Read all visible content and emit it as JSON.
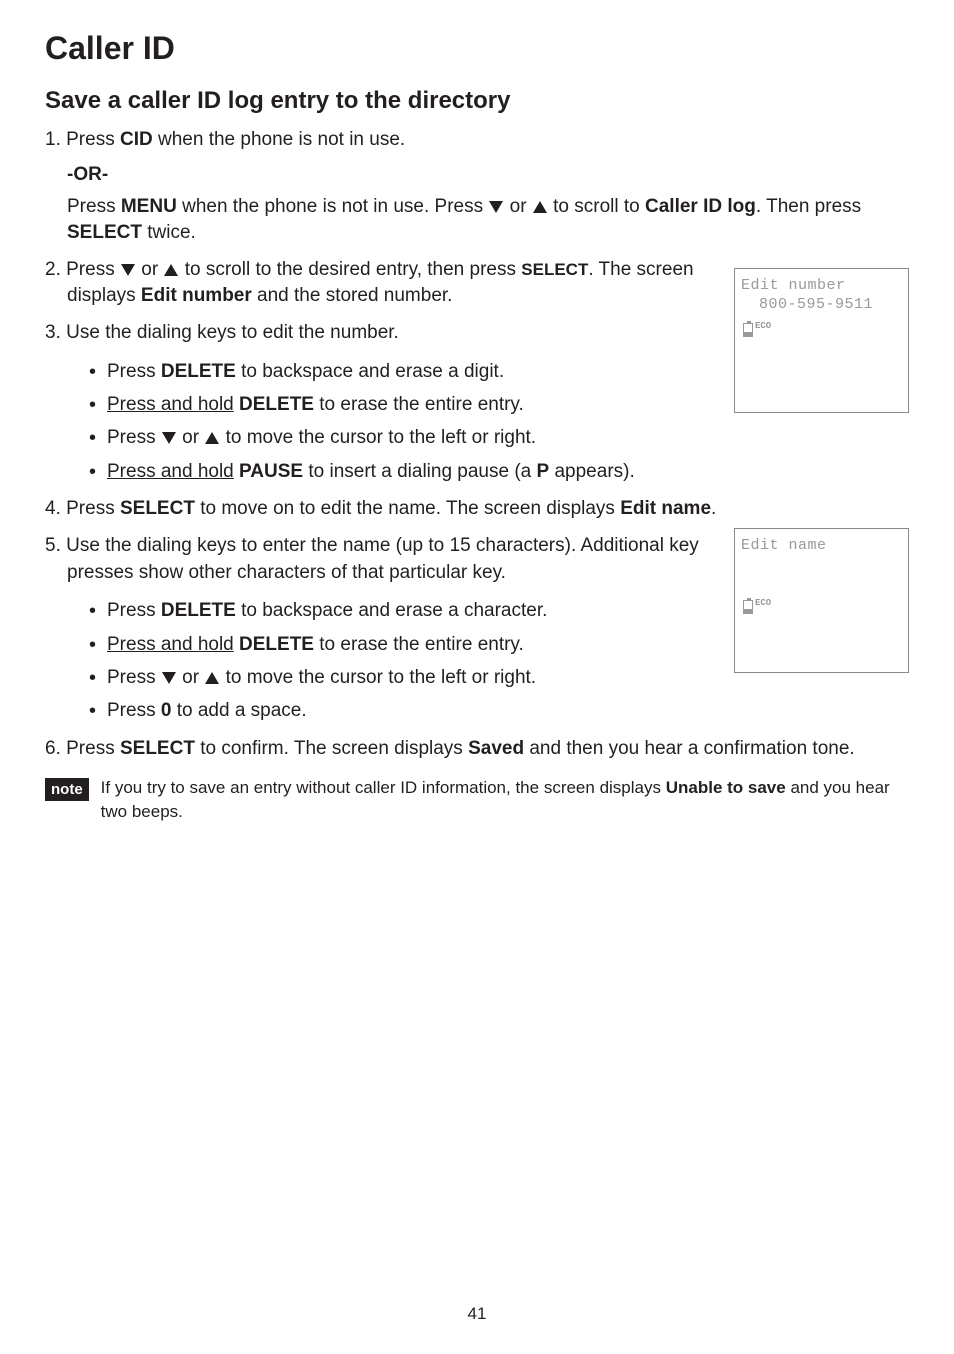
{
  "pageTitle": "Caller ID",
  "sectionTitle": "Save a caller ID log entry to the directory",
  "step1_num": "1.",
  "step1_a": " Press ",
  "step1_b": "CID",
  "step1_c": " when the phone is not in use.",
  "or": "-OR-",
  "step1_alt_a": "Press ",
  "step1_alt_b": "MENU",
  "step1_alt_c": " when the phone is not in use. Press ",
  "step1_alt_d": " or ",
  "step1_alt_e": " to scroll to ",
  "step1_alt_f": "Caller ID log",
  "step1_alt_g": ". Then press ",
  "step1_alt_h": "SELECT",
  "step1_alt_i": " twice.",
  "step2_num": "2.",
  "step2_a": " Press ",
  "step2_b": " or ",
  "step2_c": " to scroll to the desired entry, then press ",
  "step2_d": "SELECT",
  "step2_e": ". The screen displays ",
  "step2_f": "Edit number",
  "step2_g": " and the stored number.",
  "step3_num": "3.",
  "step3_a": " Use the dialing keys to edit the number.",
  "b3_1_a": "Press ",
  "b3_1_b": "DELETE",
  "b3_1_c": " to backspace and erase a digit.",
  "b3_2_a": "Press and hold",
  "b3_2_b": " DELETE",
  "b3_2_c": " to erase the entire entry.",
  "b3_3_a": "Press ",
  "b3_3_b": " or ",
  "b3_3_c": " to move the cursor to the left or right.",
  "b3_4_a": "Press and hold",
  "b3_4_b": " PAUSE",
  "b3_4_c": " to insert a dialing pause (a ",
  "b3_4_d": "P",
  "b3_4_e": " appears).",
  "step4_num": "4.",
  "step4_a": " Press ",
  "step4_b": "SELECT",
  "step4_c": " to move on to edit the name. The screen displays ",
  "step4_d": "Edit name",
  "step4_e": ".",
  "step5_num": "5.",
  "step5_a": " Use the dialing keys to enter the name (up to 15 characters). Additional key presses show other characters of that particular key.",
  "b5_1_a": "Press ",
  "b5_1_b": "DELETE",
  "b5_1_c": " to backspace and erase a character.",
  "b5_2_a": "Press and hold",
  "b5_2_b": " DELETE",
  "b5_2_c": " to erase the entire entry.",
  "b5_3_a": "Press ",
  "b5_3_b": " or ",
  "b5_3_c": " to move the cursor to the left or right.",
  "b5_4_a": "Press ",
  "b5_4_b": "0",
  "b5_4_c": " to add a space.",
  "step6_num": "6.",
  "step6_a": " Press ",
  "step6_b": "SELECT",
  "step6_c": " to confirm. The screen displays ",
  "step6_d": "Saved",
  "step6_e": " and then you hear a confirmation tone.",
  "noteBadge": "note",
  "note_a": "If you try to save an entry without caller ID information, the screen displays ",
  "note_b": "Unable to save",
  "note_c": " and you hear two beeps.",
  "screen1_line1": "Edit number",
  "screen1_line2": "800-595-9511",
  "screen2_line1": "Edit name",
  "ecoLabel": "ECO",
  "pageNumber": "41"
}
